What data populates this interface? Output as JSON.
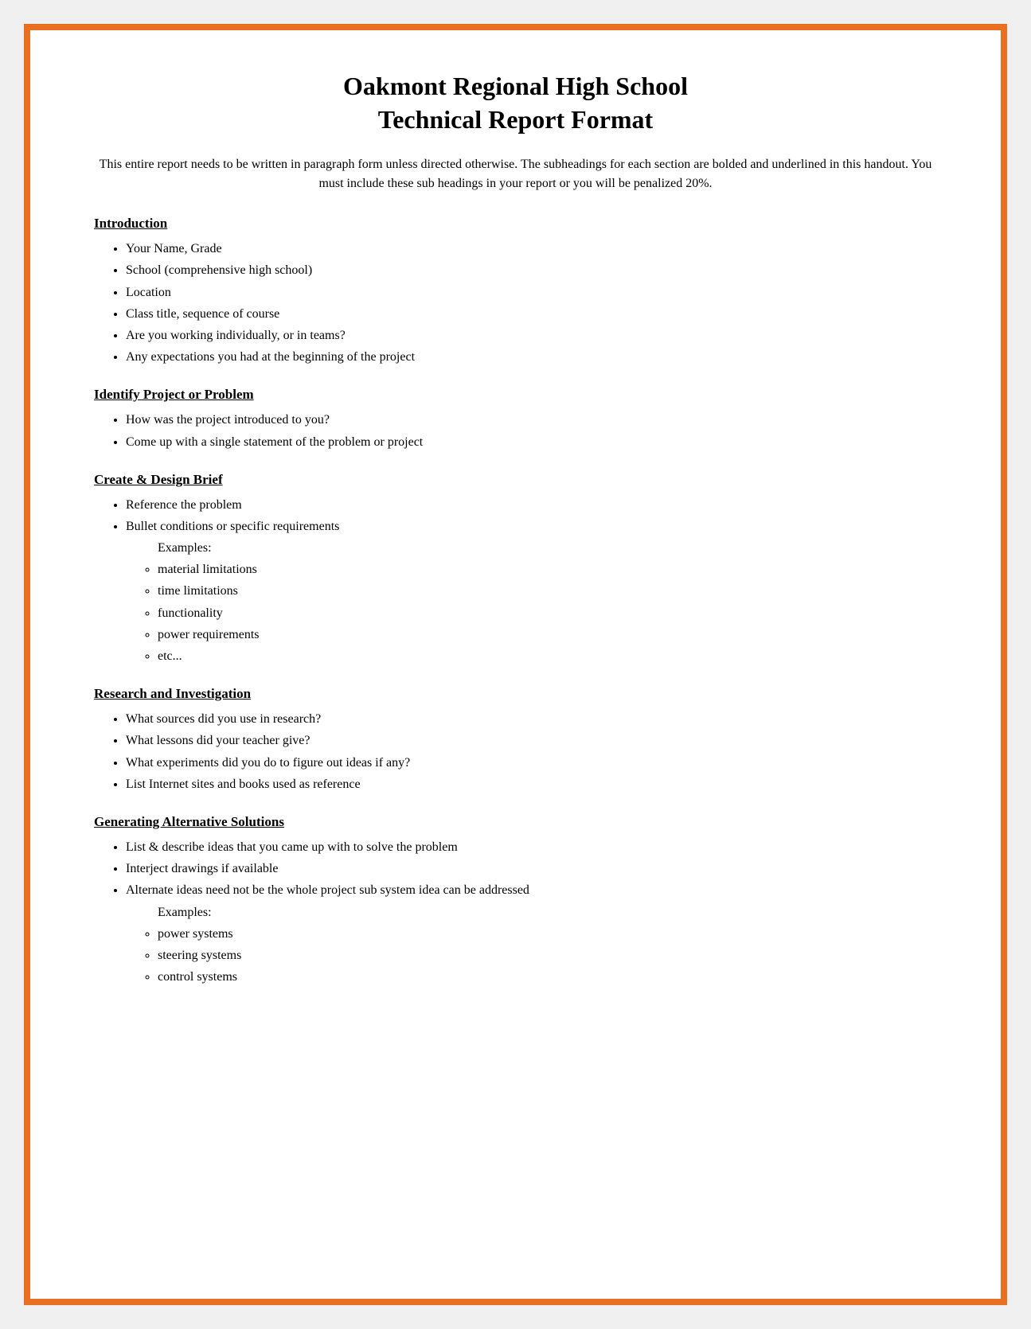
{
  "page": {
    "title_line1": "Oakmont Regional High School",
    "title_line2": "Technical Report Format",
    "intro": "This entire report needs to be written in paragraph form unless directed otherwise. The subheadings for each section are bolded and underlined in this handout. You must include these sub headings in your report or you will be penalized 20%.",
    "sections": [
      {
        "id": "introduction",
        "heading": "Introduction",
        "bullets": [
          "Your Name, Grade",
          "School (comprehensive high school)",
          "Location",
          "Class title, sequence of course",
          "Are you working individually, or in teams?",
          "Any expectations you had at the beginning of the project"
        ],
        "sub_bullets": []
      },
      {
        "id": "identify-project",
        "heading": "Identify Project or Problem",
        "bullets": [
          "How was the project introduced to you?",
          "Come up with a single statement of the problem or project"
        ],
        "sub_bullets": []
      },
      {
        "id": "create-design-brief",
        "heading": "Create & Design Brief",
        "bullets": [
          "Reference the problem",
          "Bullet conditions or specific requirements"
        ],
        "examples_label": "Examples:",
        "sub_bullets": [
          "material limitations",
          "time limitations",
          "functionality",
          "power requirements",
          "etc..."
        ]
      },
      {
        "id": "research-investigation",
        "heading": "Research and Investigation",
        "bullets": [
          "What sources did you use in research?",
          "What lessons did your teacher give?",
          "What experiments did you do to figure out ideas if any?",
          "List Internet sites and books used as reference"
        ],
        "sub_bullets": []
      },
      {
        "id": "generating-solutions",
        "heading": "Generating Alternative Solutions",
        "bullets": [
          "List & describe ideas that you came up with to solve the problem",
          "Interject drawings if available",
          "Alternate ideas need not be the whole project sub system idea can be addressed"
        ],
        "examples_label": "Examples:",
        "sub_bullets": [
          "power systems",
          "steering systems",
          "control systems"
        ]
      }
    ]
  }
}
